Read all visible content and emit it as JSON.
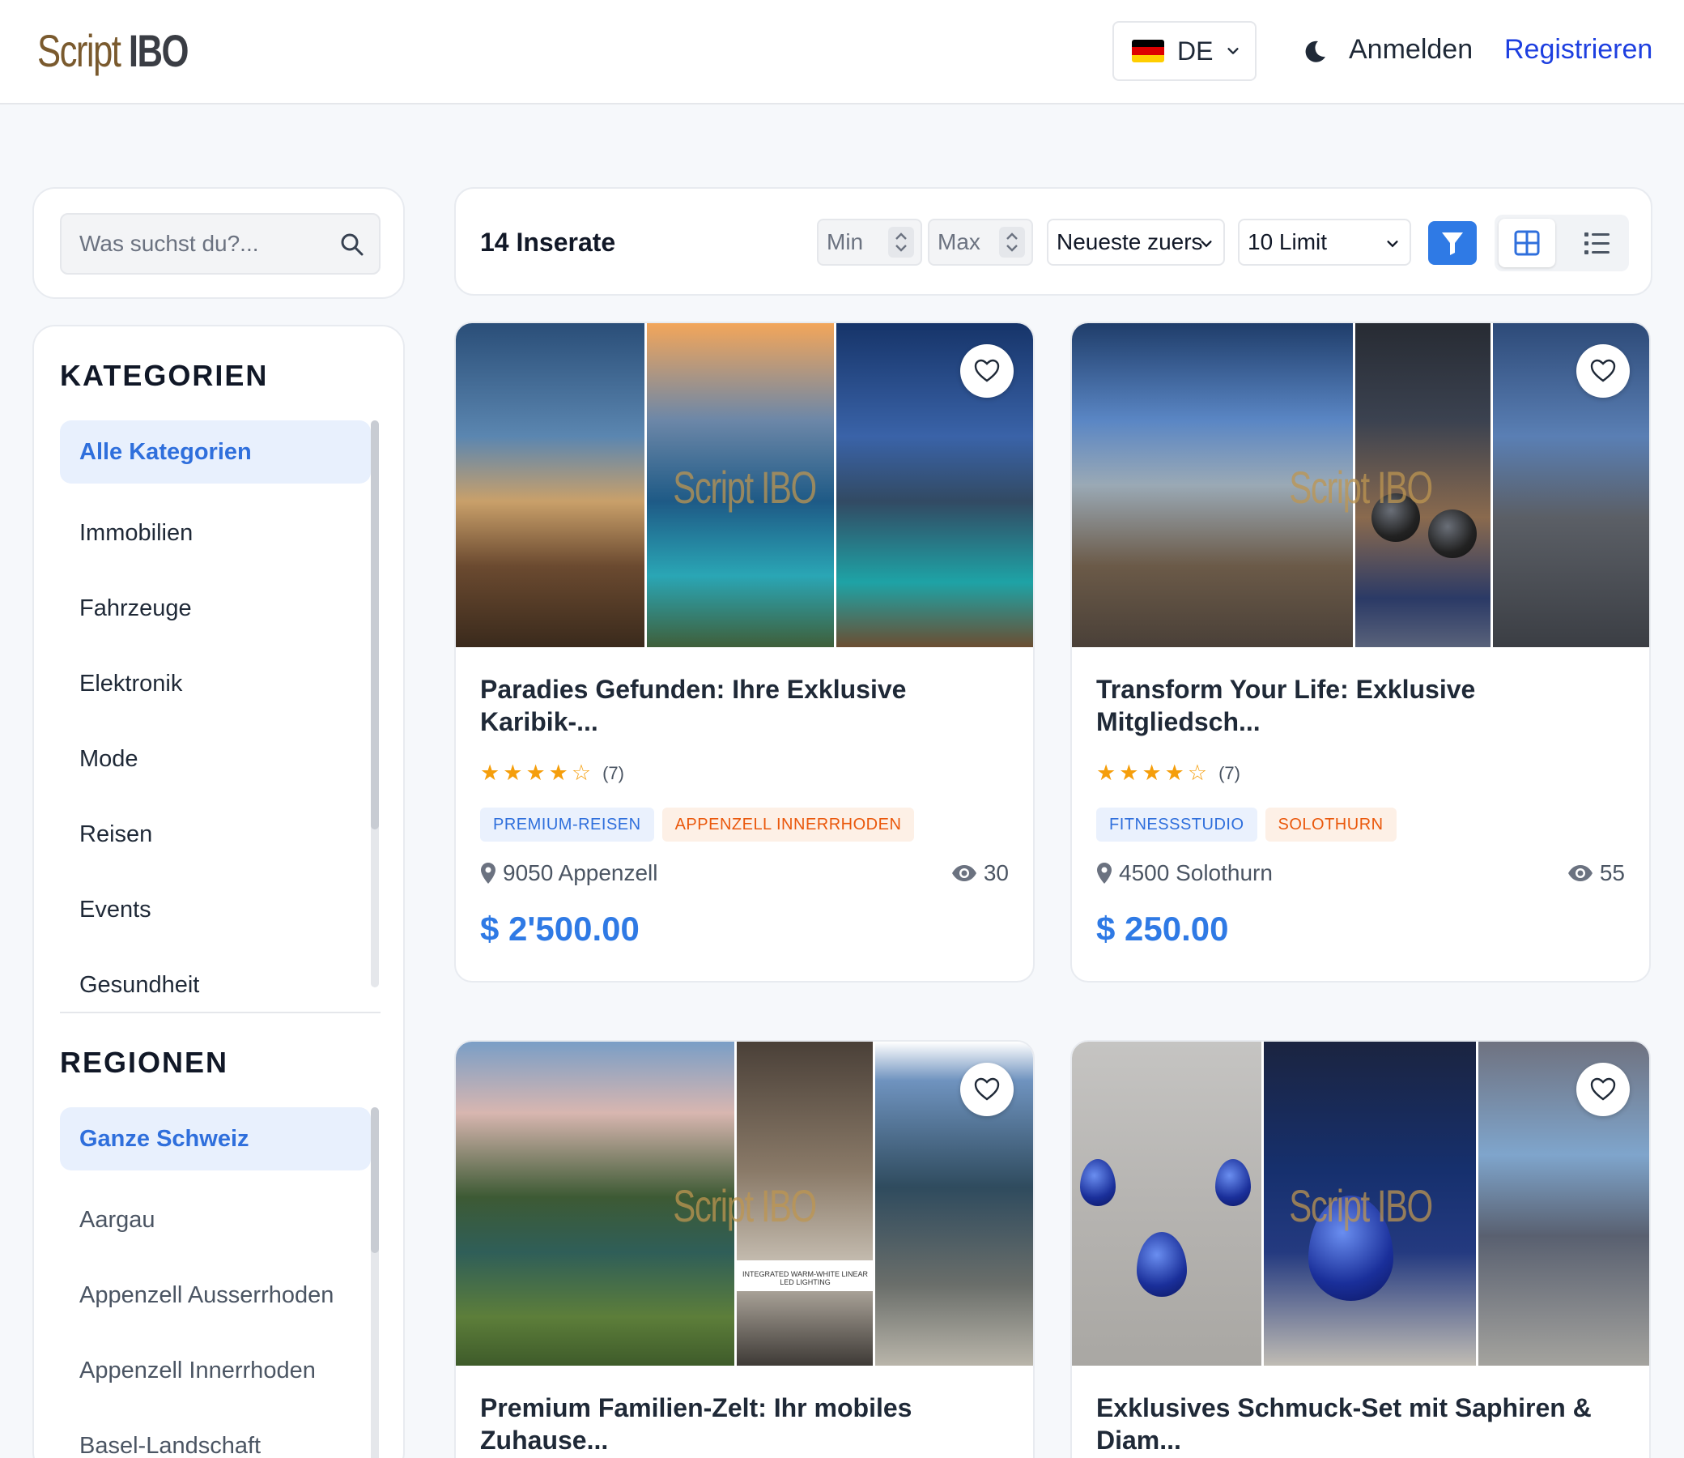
{
  "header": {
    "logo_script": "Script",
    "logo_bold": "IBO",
    "language": "DE",
    "login": "Anmelden",
    "register": "Registrieren"
  },
  "search": {
    "placeholder": "Was suchst du?..."
  },
  "categories": {
    "title": "KATEGORIEN",
    "items": [
      {
        "label": "Alle Kategorien",
        "active": true
      },
      {
        "label": "Immobilien"
      },
      {
        "label": "Fahrzeuge"
      },
      {
        "label": "Elektronik"
      },
      {
        "label": "Mode"
      },
      {
        "label": "Reisen"
      },
      {
        "label": "Events"
      },
      {
        "label": "Gesundheit"
      }
    ]
  },
  "regions": {
    "title": "REGIONEN",
    "items": [
      {
        "label": "Ganze Schweiz",
        "active": true
      },
      {
        "label": "Aargau"
      },
      {
        "label": "Appenzell Ausserrhoden"
      },
      {
        "label": "Appenzell Innerrhoden"
      },
      {
        "label": "Basel-Landschaft"
      }
    ]
  },
  "toolbar": {
    "count": "14 Inserate",
    "min_placeholder": "Min",
    "max_placeholder": "Max",
    "sort": "Neueste zuers",
    "limit": "10 Limit"
  },
  "listings": [
    {
      "title": "Paradies Gefunden: Ihre Exklusive Karibik-...",
      "rating_count": "(7)",
      "stars": 4,
      "tag_category": "PREMIUM-REISEN",
      "tag_region": "APPENZELL INNERRHODEN",
      "location": "9050 Appenzell",
      "views": "30",
      "price": "$ 2'500.00",
      "watermark": "Script IBO"
    },
    {
      "title": "Transform Your Life: Exklusive Mitgliedsch...",
      "rating_count": "(7)",
      "stars": 4,
      "tag_category": "FITNESSSTUDIO",
      "tag_region": "SOLOTHURN",
      "location": "4500 Solothurn",
      "views": "55",
      "price": "$ 250.00",
      "watermark": "Script IBO"
    },
    {
      "title": "Premium Familien-Zelt: Ihr mobiles Zuhause...",
      "watermark": "Script IBO",
      "image_caption": "INTEGRATED WARM-WHITE LINEAR LED LIGHTING"
    },
    {
      "title": "Exklusives Schmuck-Set mit Saphiren & Diam...",
      "watermark": "Script IBO"
    }
  ],
  "colors": {
    "accent": "#2f7ae5",
    "register_link": "#1d3fe0",
    "tag_blue": "#2f6fdc",
    "tag_orange": "#ea580c",
    "star": "#f59e0b"
  }
}
